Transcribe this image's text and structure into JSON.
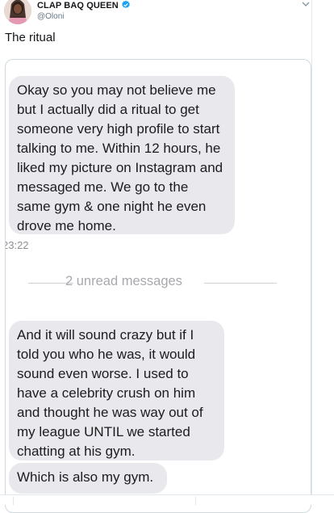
{
  "tweet": {
    "display_name": "CLAP BAQ QUEEN",
    "handle": "@Oloni",
    "text": "The ritual",
    "verified": true
  },
  "screenshot": {
    "messages": [
      "Okay so you may not believe me but I actually did a ritual to get someone very high profile to start talking to me. Within 12 hours, he liked my picture on Instagram and messaged me. We go to the same gym & one night he even drove me home.",
      "And it will sound crazy but if I told you who he was, it would sound even worse. I used to have a celebrity crush on him and thought he was way out of my league UNTIL we started chatting at his gym.",
      "Which is also my gym."
    ],
    "timestamp": "23:22",
    "unread_label": "2 unread messages"
  },
  "icons": [
    "avatar",
    "verified-badge-icon",
    "chevron-down-icon"
  ],
  "colors": {
    "bubble": "#e9e9ed",
    "verified": "#1da1f2",
    "handle": "#657786",
    "border": "#cfd9de"
  }
}
